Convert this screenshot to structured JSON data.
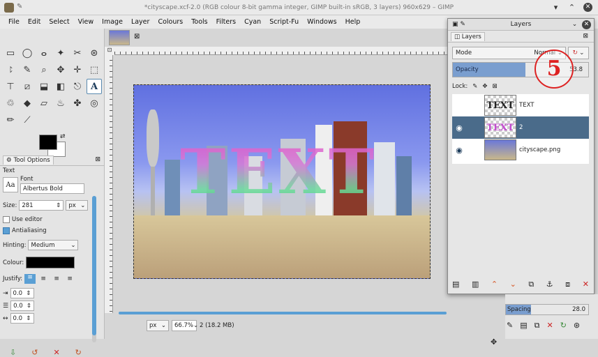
{
  "window": {
    "title": "*cityscape.xcf-2.0 (RGB colour 8-bit gamma integer, GIMP built-in sRGB, 3 layers) 960x629 – GIMP",
    "controls": [
      "▾",
      "⌃",
      "✕"
    ]
  },
  "menu": [
    "File",
    "Edit",
    "Select",
    "View",
    "Image",
    "Layer",
    "Colours",
    "Tools",
    "Filters",
    "Cyan",
    "Script-Fu",
    "Windows",
    "Help"
  ],
  "toolbox": {
    "tools": [
      "▭",
      "◯",
      "ⴰ",
      "✦",
      "✂",
      "⊛",
      "⥏",
      "✎",
      "⌕",
      "✥",
      "✛",
      "⬚",
      "⊤",
      "⧄",
      "⬓",
      "◧",
      "⎋",
      "A",
      "♲",
      "◆",
      "▱",
      "♨",
      "✤",
      "◎",
      "✏",
      "⟋"
    ],
    "active_tool_index": 17,
    "fg_color": "#000000",
    "bg_color": "#ffffff"
  },
  "tool_options": {
    "tab_label": "Tool Options",
    "section": "Text",
    "font_label": "Font",
    "font_value": "Albertus Bold",
    "font_preview": "Aa",
    "size_label": "Size:",
    "size_value": "281",
    "size_unit": "px",
    "use_editor": "Use editor",
    "antialiasing": "Antialiasing",
    "hinting_label": "Hinting:",
    "hinting_value": "Medium",
    "colour_label": "Colour:",
    "justify_label": "Justify:",
    "indent_value": "0.0",
    "line_spacing_value": "0.0",
    "letter_spacing_value": "0.0"
  },
  "canvas": {
    "overlay_text": "TEXT",
    "unit": "px",
    "zoom": "66.7%",
    "status": "2 (18.2 MB)"
  },
  "layers_panel": {
    "title": "Layers",
    "tab_label": "Layers",
    "mode_label": "Mode",
    "mode_value": "Normal",
    "opacity_label": "Opacity",
    "opacity_value": "53.8",
    "opacity_fraction": 0.538,
    "lock_label": "Lock:",
    "badge": "5",
    "layers": [
      {
        "name": "TEXT",
        "thumb": "TEXT",
        "visible": false,
        "selected": false
      },
      {
        "name": "2",
        "thumb": "TEXT",
        "visible": true,
        "selected": true
      },
      {
        "name": "cityscape.png",
        "thumb": "",
        "visible": true,
        "selected": false
      }
    ]
  },
  "brush_dock": {
    "spacing_label": "Spacing",
    "spacing_value": "28.0"
  }
}
